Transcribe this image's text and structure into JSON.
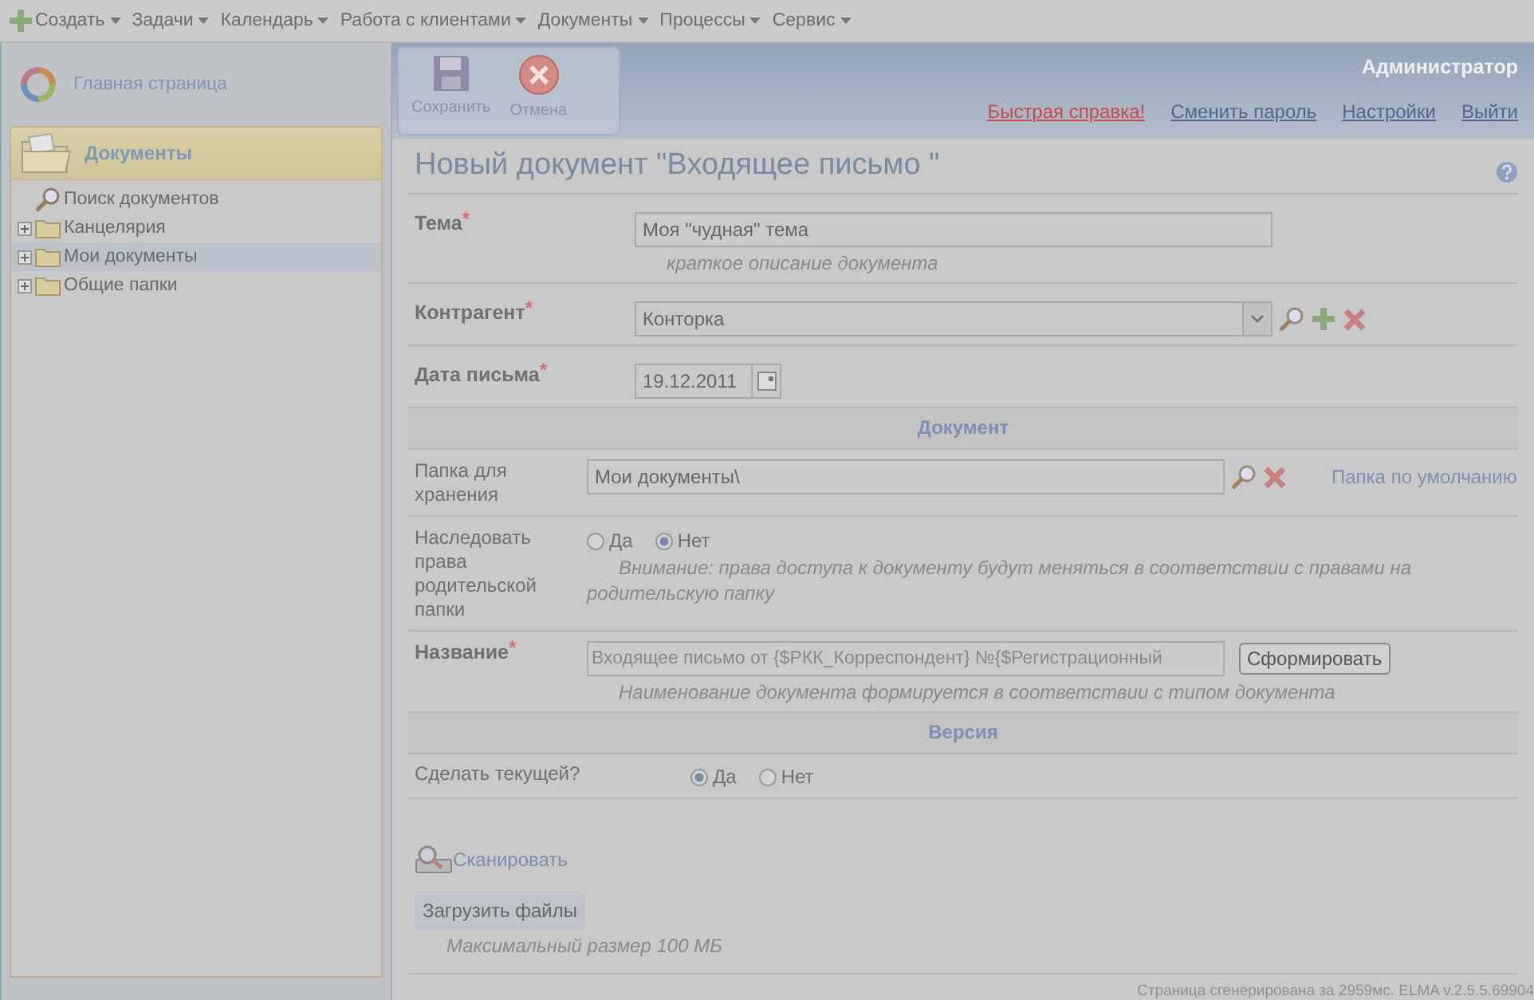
{
  "menu": [
    {
      "label": "Создать",
      "kind": "create"
    },
    {
      "label": "Задачи",
      "kind": "plain"
    },
    {
      "label": "Календарь",
      "kind": "plain"
    },
    {
      "label": "Работа с клиентами",
      "kind": "plain"
    },
    {
      "label": "Документы",
      "kind": "plain"
    },
    {
      "label": "Процессы",
      "kind": "plain"
    },
    {
      "label": "Сервис",
      "kind": "plain"
    }
  ],
  "sidebar": {
    "home_link": "Главная страница",
    "section_title": "Документы",
    "tree": [
      {
        "label": "Поиск документов",
        "kind": "search",
        "selected": false
      },
      {
        "label": "Канцелярия",
        "kind": "folder",
        "selected": false
      },
      {
        "label": "Мои документы",
        "kind": "folder",
        "selected": true
      },
      {
        "label": "Общие папки",
        "kind": "folder",
        "selected": false
      }
    ]
  },
  "toolbar": [
    {
      "label": "Сохранить",
      "kind": "save"
    },
    {
      "label": "Отмена",
      "kind": "cancel"
    }
  ],
  "user": "Администратор",
  "required_mark": "*",
  "header_links": [
    {
      "label": "Быстрая справка!",
      "kind": "alert"
    },
    {
      "label": "Сменить пароль",
      "kind": "plain"
    },
    {
      "label": "Настройки",
      "kind": "plain"
    },
    {
      "label": "Выйти",
      "kind": "plain"
    }
  ],
  "title": "Новый документ \"Входящее письмо \"",
  "sections": [
    {
      "rows": [
        {
          "kind": "text",
          "label": "Тема",
          "required": true,
          "value": "Моя \"чудная\" тема",
          "hint": "краткое описание документа"
        },
        {
          "kind": "select",
          "label": "Контрагент",
          "required": true,
          "value": "Конторка"
        },
        {
          "kind": "date",
          "label": "Дата письма",
          "required": true,
          "value": "19.12.2011"
        }
      ]
    },
    {
      "title": "Документ",
      "rows": [
        {
          "kind": "path",
          "label": "Папка для хранения",
          "required": false,
          "value": "Мои документы\\",
          "link": "Папка по умолчанию"
        },
        {
          "kind": "radio",
          "label": "Наследовать права родительской папки",
          "required": false,
          "options": [
            {
              "label": "Да",
              "selected": false
            },
            {
              "label": "Нет",
              "selected": true
            }
          ],
          "hint": "Внимание: права доступа к документу будут меняться в соответствии с правами на родительскую папку"
        },
        {
          "kind": "formula",
          "label": "Название",
          "required": true,
          "value": "Входящее письмо от {$РКК_Корреспондент} №{$Регистрационный",
          "button": "Сформировать",
          "hint": "Наименование документа формируется в соответствии с типом документа"
        }
      ]
    },
    {
      "title": "Версия",
      "rows": [
        {
          "kind": "radio",
          "label": "Сделать текущей?",
          "required": false,
          "options": [
            {
              "label": "Да",
              "selected": true
            },
            {
              "label": "Нет",
              "selected": false
            }
          ]
        }
      ]
    }
  ],
  "scan_link": "Сканировать",
  "upload_button": "Загрузить файлы",
  "upload_hint": "Максимальный размер 100 МБ",
  "footer": "Страница сгенерирована за 2959мс. ELMA  v.2.5.5.69904"
}
